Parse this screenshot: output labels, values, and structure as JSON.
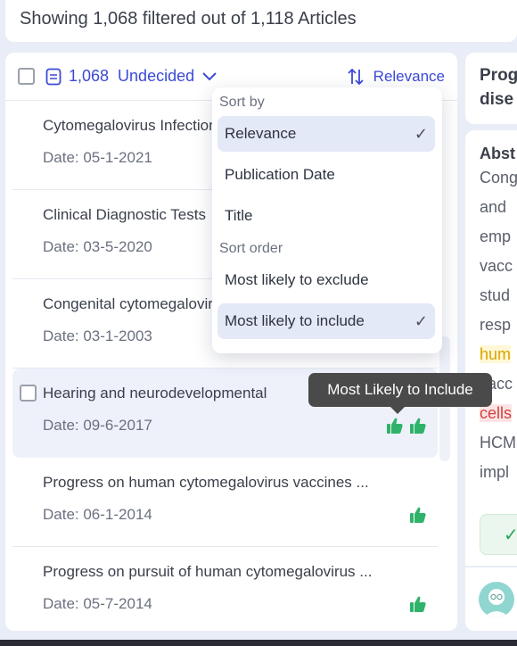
{
  "banner": {
    "text": "Showing 1,068 filtered out of 1,118 Articles"
  },
  "list_header": {
    "count": "1,068",
    "filter_label": "Undecided",
    "sort_label": "Relevance"
  },
  "articles": [
    {
      "title": "Cytomegalovirus Infection",
      "date": "Date: 05-1-2021",
      "thumbs": 0
    },
    {
      "title": "Clinical Diagnostic Tests",
      "date": "Date: 03-5-2020",
      "thumbs": 0
    },
    {
      "title": "Congenital cytomegalovirus",
      "date": "Date: 03-1-2003",
      "thumbs": 0
    },
    {
      "title": "Hearing and neurodevelopmental",
      "date": "Date: 09-6-2017",
      "thumbs": 2
    },
    {
      "title": "Progress on human cytomegalovirus vaccines ...",
      "date": "Date: 06-1-2014",
      "thumbs": 1
    },
    {
      "title": "Progress on pursuit of human cytomegalovirus ...",
      "date": "Date: 05-7-2014",
      "thumbs": 1
    }
  ],
  "dropdown": {
    "sort_by_label": "Sort by",
    "sort_by_options": [
      {
        "label": "Relevance",
        "selected": true
      },
      {
        "label": "Publication Date",
        "selected": false
      },
      {
        "label": "Title",
        "selected": false
      }
    ],
    "sort_order_label": "Sort order",
    "sort_order_options": [
      {
        "label": "Most likely to exclude",
        "selected": false
      },
      {
        "label": "Most likely to include",
        "selected": true
      }
    ],
    "check_glyph": "✓"
  },
  "tooltip": {
    "text": "Most Likely to Include"
  },
  "detail": {
    "title_lines": [
      "Prog",
      "dise"
    ],
    "abstract_heading": "Abst",
    "abstract_lines": [
      "Cong",
      "and",
      "emp",
      "vacc",
      "stud",
      "resp",
      "hum",
      "vacc",
      "cells",
      "HCM",
      "impl"
    ]
  },
  "colors": {
    "accent": "#3b4bd6",
    "thumb_green": "#2fb36a",
    "highlight_yellow": "#d9a400",
    "highlight_red": "#d24040"
  }
}
